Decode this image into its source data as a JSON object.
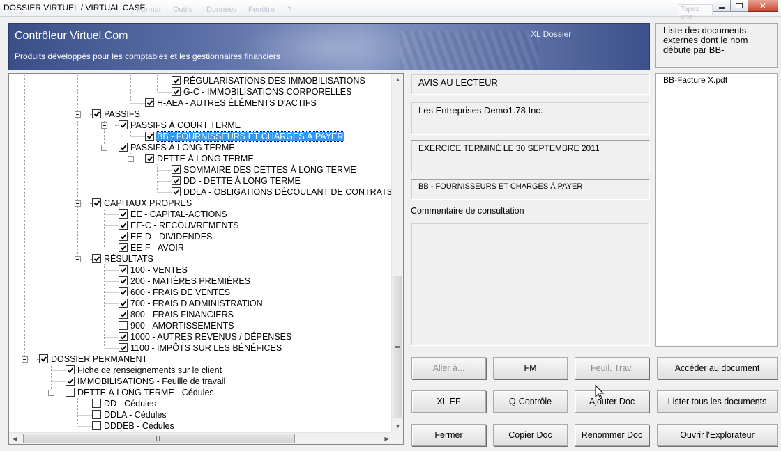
{
  "window": {
    "title": "DOSSIER VIRTUEL / VIRTUAL CASE",
    "background_menu": [
      "Format",
      "Outils",
      "Données",
      "Fenêtre",
      "?"
    ],
    "background_search": "Tapez une"
  },
  "banner": {
    "title": "Contrôleur Virtuel.Com",
    "subtitle": "Produits développés pour les comptables et les gestionnaires financiers",
    "tag": "XL Dossier"
  },
  "doc_info_label": "Liste des documents externes dont le nom débute par BB-",
  "tree": {
    "nodes": [
      {
        "label": "RÉGULARISATIONS DES IMMOBILISATIONS",
        "checked": true
      },
      {
        "label": "G-C - IMMOBILISATIONS CORPORELLES",
        "checked": true
      },
      {
        "label": "H-AEA - AUTRES ÉLÉMENTS D'ACTIFS",
        "checked": true
      },
      {
        "label": "PASSIFS",
        "checked": true
      },
      {
        "label": "PASSIFS À COURT TERME",
        "checked": true
      },
      {
        "label": "BB - FOURNISSEURS ET CHARGES À PAYER",
        "checked": true
      },
      {
        "label": "PASSIFS À LONG TERME",
        "checked": true
      },
      {
        "label": "DETTE À LONG TERME",
        "checked": true
      },
      {
        "label": "SOMMAIRE DES DETTES À LONG TERME",
        "checked": true
      },
      {
        "label": "DD - DETTE À LONG TERME",
        "checked": true
      },
      {
        "label": "DDLA - OBLIGATIONS DÉCOULANT DE CONTRATS DE LOCATION-ACQUISITION",
        "checked": true
      },
      {
        "label": "CAPITAUX PROPRES",
        "checked": true
      },
      {
        "label": "EE - CAPITAL-ACTIONS",
        "checked": true
      },
      {
        "label": "EE-C - RECOUVREMENTS",
        "checked": true
      },
      {
        "label": "EE-D - DIVIDENDES",
        "checked": true
      },
      {
        "label": "EE-F - AVOIR",
        "checked": true
      },
      {
        "label": "RÉSULTATS",
        "checked": true
      },
      {
        "label": "100 - VENTES",
        "checked": true
      },
      {
        "label": "200 - MATIÈRES PREMIÈRES",
        "checked": true
      },
      {
        "label": "600 - FRAIS DE VENTES",
        "checked": true
      },
      {
        "label": "700 - FRAIS D'ADMINISTRATION",
        "checked": true
      },
      {
        "label": "800 - FRAIS FINANCIERS",
        "checked": true
      },
      {
        "label": "900 - AMORTISSEMENTS",
        "checked": false
      },
      {
        "label": "1000 - AUTRES REVENUS / DÉPENSES",
        "checked": true
      },
      {
        "label": "1100 - IMPÔTS SUR LES BÉNÉFICES",
        "checked": true
      },
      {
        "label": "DOSSIER PERMANENT",
        "checked": true
      },
      {
        "label": "Fiche de renseignements sur le client",
        "checked": true
      },
      {
        "label": "IMMOBILISATIONS - Feuille de travail",
        "checked": true
      },
      {
        "label": "DETTE À LONG TERME - Cédules",
        "checked": false
      },
      {
        "label": "DD - Cédules",
        "checked": false
      },
      {
        "label": "DDLA - Cédules",
        "checked": false
      },
      {
        "label": "DDDEB - Cédules",
        "checked": false
      }
    ]
  },
  "fields": {
    "avis": "AVIS AU LECTEUR",
    "entreprise": "Les Entreprises Demo1.78 Inc.",
    "exercice": "EXERCICE TERMINÉ LE 30 SEPTEMBRE 2011",
    "section": "BB - FOURNISSEURS ET CHARGES À PAYER",
    "comment_label": "Commentaire de consultation"
  },
  "documents": [
    "BB-Facture X.pdf"
  ],
  "buttons": {
    "aller": "Aller à...",
    "fm": "FM",
    "feuil": "Feuil. Trav.",
    "acceder": "Accéder au document",
    "xlef": "XL EF",
    "qcontrole": "Q-Contrôle",
    "ajouter": "Ajouter Doc",
    "lister": "Lister tous les documents",
    "fermer": "Fermer",
    "copier": "Copier Doc",
    "renommer": "Renommer Doc",
    "ouvrir": "Ouvrir l'Explorateur"
  }
}
